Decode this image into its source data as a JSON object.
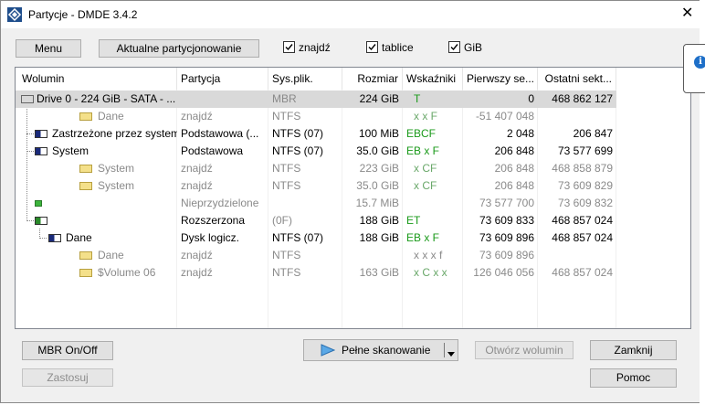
{
  "window": {
    "title": "Partycje - DMDE 3.4.2"
  },
  "toolbar": {
    "menu_label": "Menu",
    "current_partitioning_label": "Aktualne partycjonowanie",
    "checkboxes": [
      {
        "label": "znajdź",
        "checked": true
      },
      {
        "label": "tablice",
        "checked": true
      },
      {
        "label": "GiB",
        "checked": true
      }
    ]
  },
  "table": {
    "columns": [
      "Wolumin",
      "Partycja",
      "Sys.plik.",
      "Rozmiar",
      "Wskaźniki",
      "Pierwszy se...",
      "Ostatni sekt..."
    ],
    "rows": [
      {
        "volume": "Drive 0 - 224 GiB - SATA - ...",
        "partition": "",
        "fs": "MBR",
        "size": "224 GiB",
        "flags": "T",
        "first": "0",
        "last": "468 862 127"
      },
      {
        "volume": "Dane",
        "partition": "znajdź",
        "fs": "NTFS",
        "size": "",
        "flags": "x x F",
        "first": "-51 407 048",
        "last": ""
      },
      {
        "volume": "Zastrzeżone przez system",
        "partition": "Podstawowa (...",
        "fs": "NTFS (07)",
        "size": "100 MiB",
        "flags": "EBCF",
        "first": "2 048",
        "last": "206 847"
      },
      {
        "volume": "System",
        "partition": "Podstawowa",
        "fs": "NTFS (07)",
        "size": "35.0 GiB",
        "flags": "EB x F",
        "first": "206 848",
        "last": "73 577 699"
      },
      {
        "volume": "System",
        "partition": "znajdź",
        "fs": "NTFS",
        "size": "223 GiB",
        "flags": "x CF",
        "first": "206 848",
        "last": "468 858 879"
      },
      {
        "volume": "System",
        "partition": "znajdź",
        "fs": "NTFS",
        "size": "35.0 GiB",
        "flags": "x CF",
        "first": "206 848",
        "last": "73 609 829"
      },
      {
        "volume": "",
        "partition": "Nieprzydzielone",
        "fs": "",
        "size": "15.7 MiB",
        "flags": "",
        "first": "73 577 700",
        "last": "73 609 832"
      },
      {
        "volume": "",
        "partition": "Rozszerzona",
        "fs": "(0F)",
        "size": "188 GiB",
        "flags": "ET",
        "first": "73 609 833",
        "last": "468 857 024"
      },
      {
        "volume": "Dane",
        "partition": "Dysk logicz.",
        "fs": "NTFS (07)",
        "size": "188 GiB",
        "flags": "EB x F",
        "first": "73 609 896",
        "last": "468 857 024"
      },
      {
        "volume": "Dane",
        "partition": "znajdź",
        "fs": "NTFS",
        "size": "",
        "flags": "x x x f",
        "first": "73 609 896",
        "last": ""
      },
      {
        "volume": "$Volume 06",
        "partition": "znajdź",
        "fs": "NTFS",
        "size": "163 GiB",
        "flags": "x C x x",
        "first": "126 046 056",
        "last": "468 857 024"
      }
    ]
  },
  "buttons": {
    "mbr_onoff": "MBR On/Off",
    "apply": "Zastosuj",
    "full_scan": "Pełne skanowanie",
    "open_volume": "Otwórz wolumin",
    "close": "Zamknij",
    "help": "Pomoc"
  },
  "close_glyph": "✕",
  "info_glyph": "i",
  "colors": {
    "flag_green": "#1a9a1a",
    "selected_row": "#d9d9d9",
    "disabled_text": "#8d8d8d"
  }
}
